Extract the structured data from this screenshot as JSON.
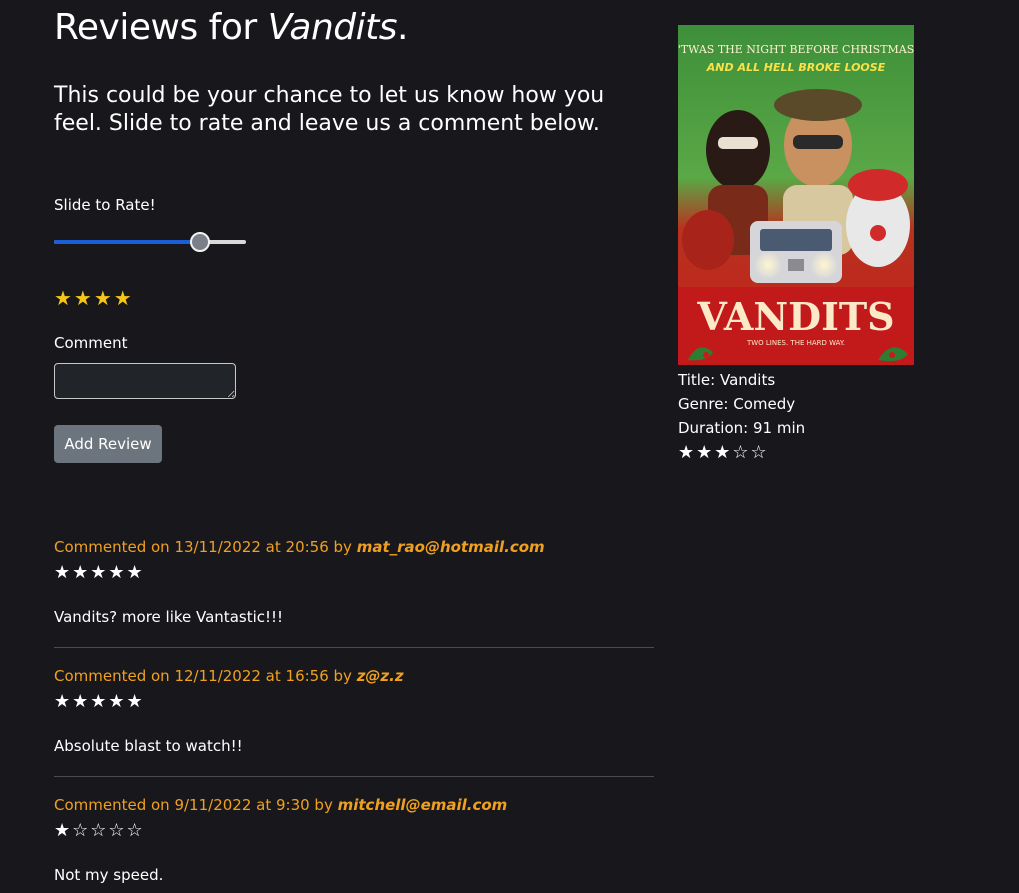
{
  "header": {
    "title_prefix": "Reviews for ",
    "movie_name": "Vandits",
    "title_suffix": "."
  },
  "intro": "This could be your chance to let us know how you feel. Slide to rate and leave us a comment below.",
  "form": {
    "slide_label": "Slide to Rate!",
    "slider_value": 4,
    "slider_max": 5,
    "rating_stars": "★★★★",
    "comment_label": "Comment",
    "comment_value": "",
    "add_button": "Add Review"
  },
  "movie": {
    "poster_tagline_1": "'TWAS THE NIGHT BEFORE CHRISTMAS",
    "poster_tagline_2": "AND ALL HELL BROKE LOOSE",
    "poster_title": "VANDITS",
    "poster_subtitle": "TWO LINES. THE HARD WAY.",
    "title_line": "Title: Vandits",
    "genre_line": "Genre: Comedy",
    "duration_line": "Duration: 91 min",
    "rating": 3,
    "stars": "★★★☆☆"
  },
  "reviews": [
    {
      "meta": "Commented on 13/11/2022 at 20:56 by ",
      "author": "mat_rao@hotmail.com",
      "rating": 5,
      "stars": "★★★★★",
      "text": "Vandits? more like Vantastic!!!"
    },
    {
      "meta": "Commented on 12/11/2022 at 16:56 by ",
      "author": "z@z.z",
      "rating": 5,
      "stars": "★★★★★",
      "text": "Absolute blast to watch!!"
    },
    {
      "meta": "Commented on 9/11/2022 at 9:30 by ",
      "author": "mitchell@email.com",
      "rating": 1,
      "stars": "★☆☆☆☆",
      "text": "Not my speed."
    }
  ],
  "colors": {
    "background": "#18181c",
    "accent_orange": "#f0a020",
    "star_gold": "#f5c518",
    "slider_blue": "#1a5fd6",
    "button_grey": "#6c757d"
  }
}
